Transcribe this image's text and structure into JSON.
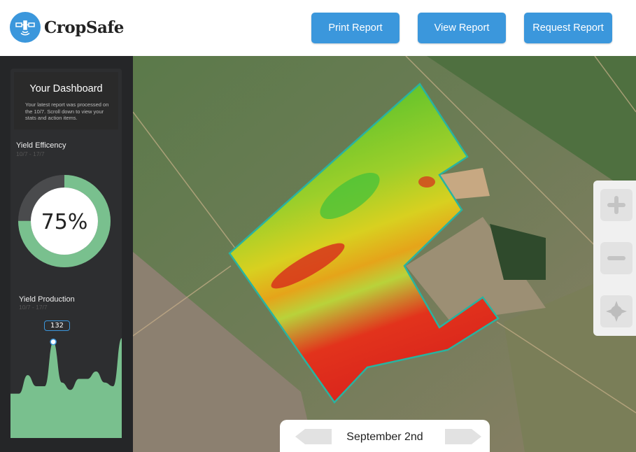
{
  "brand": {
    "name": "CropSafe",
    "logo_icon": "satellite-icon",
    "accent": "#3b97dc"
  },
  "header": {
    "buttons": [
      "Print Report",
      "View Report",
      "Request Report"
    ]
  },
  "sidebar": {
    "title": "Your Dashboard",
    "subtitle": "Your latest report was processed on the 10/7. Scroll down to view your stats and action items.",
    "efficiency": {
      "label": "Yield Efficency",
      "range": "10/7 - 17/7",
      "value": "75%",
      "percent": 75,
      "color": "#79c08e"
    },
    "production": {
      "label": "Yield Production",
      "range": "10/7 - 17/7",
      "tooltip": "132",
      "series": [
        60,
        60,
        85,
        70,
        70,
        130,
        75,
        65,
        80,
        80,
        90,
        75,
        70,
        135
      ]
    }
  },
  "map": {
    "zoom_in": "plus-icon",
    "zoom_out": "minus-icon",
    "recenter": "compass-icon"
  },
  "date_nav": {
    "label": "September 2nd"
  }
}
